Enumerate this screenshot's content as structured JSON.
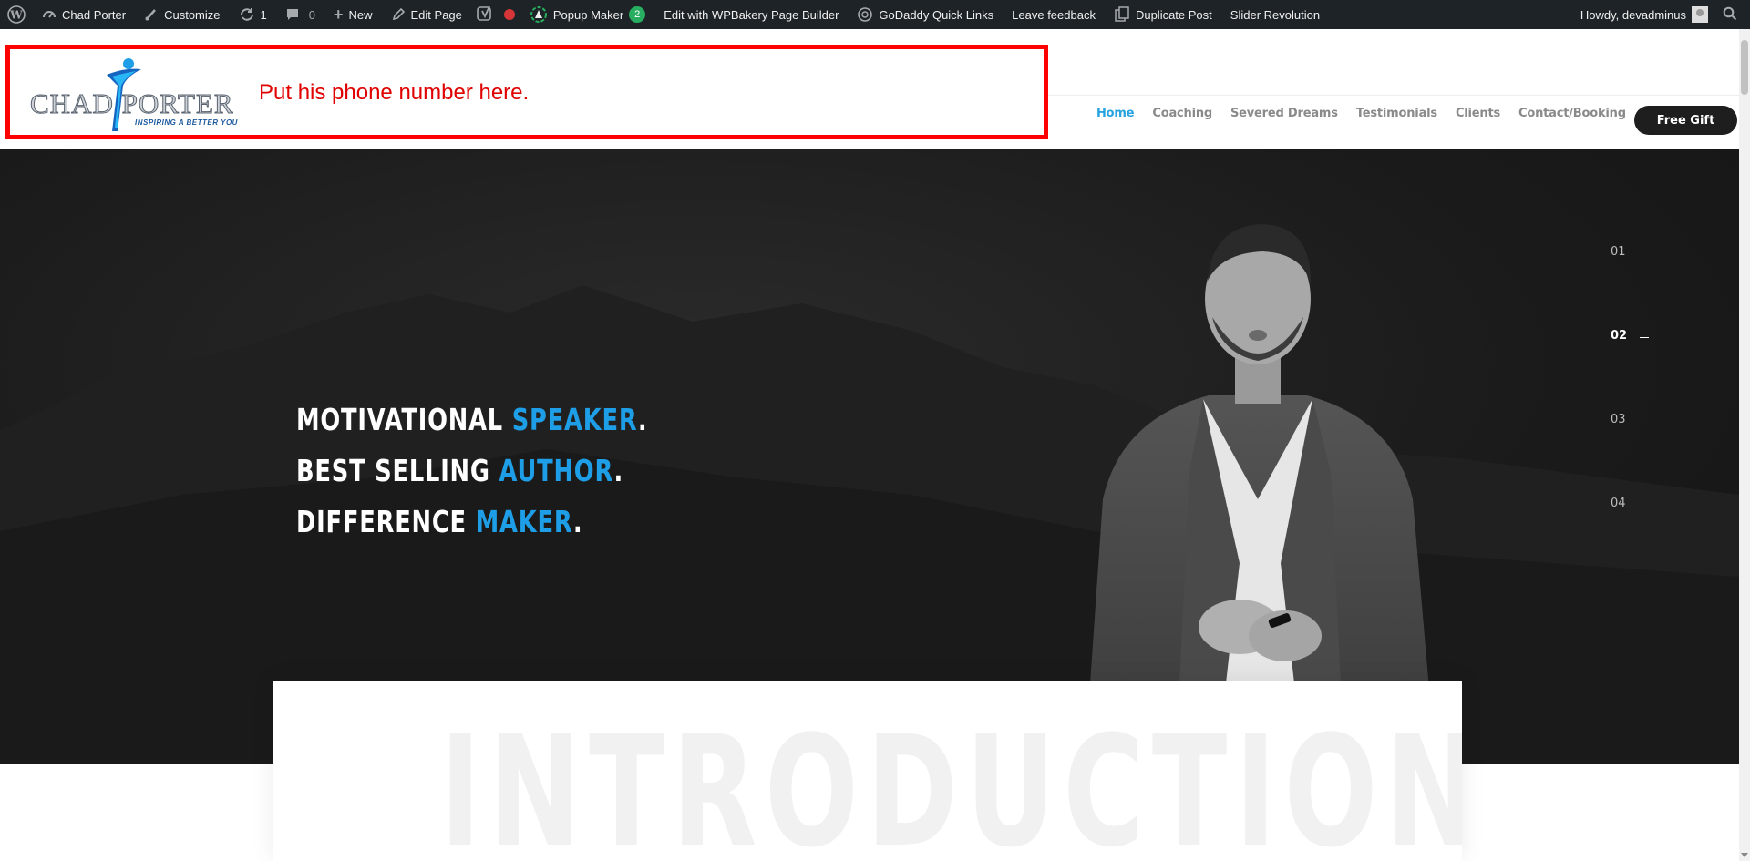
{
  "admin_bar": {
    "site_name": "Chad Porter",
    "customize": "Customize",
    "updates_count": "1",
    "comments_count": "0",
    "new": "New",
    "edit_page": "Edit Page",
    "popup_maker": "Popup Maker",
    "popup_maker_badge": "2",
    "wpbakery": "Edit with WPBakery Page Builder",
    "godaddy": "GoDaddy Quick Links",
    "feedback": "Leave feedback",
    "duplicate": "Duplicate Post",
    "slider": "Slider Revolution",
    "howdy": "Howdy, devadminus"
  },
  "header": {
    "logo_text": "CHAD PORTER",
    "logo_tagline": "INSPIRING A BETTER YOU",
    "annotation": "Put his phone number here.",
    "nav": [
      {
        "label": "Home",
        "active": true
      },
      {
        "label": "Coaching"
      },
      {
        "label": "Severed Dreams"
      },
      {
        "label": "Testimonials"
      },
      {
        "label": "Clients"
      },
      {
        "label": "Contact/Booking"
      }
    ],
    "cta": "Free Gift"
  },
  "hero": {
    "lines": [
      {
        "prefix": "MOTIVATIONAL ",
        "accent": "SPEAKER",
        "suffix": "."
      },
      {
        "prefix": "BEST SELLING ",
        "accent": "AUTHOR",
        "suffix": "."
      },
      {
        "prefix": "DIFFERENCE ",
        "accent": "MAKER",
        "suffix": "."
      }
    ],
    "slides": [
      "01",
      "02",
      "03",
      "04"
    ],
    "active_slide": "02"
  },
  "intro": {
    "watermark": "INTRODUCTION"
  },
  "colors": {
    "admin_bg": "#1d2327",
    "accent": "#1e9ee6",
    "annotation": "#ff0000"
  }
}
